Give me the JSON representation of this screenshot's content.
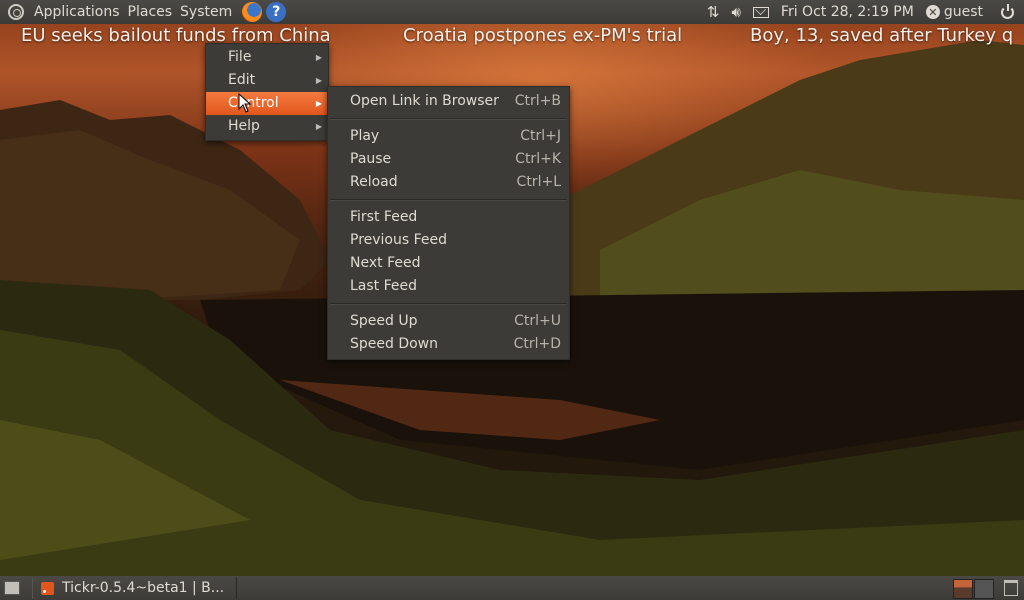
{
  "top_panel": {
    "menus": [
      "Applications",
      "Places",
      "System"
    ],
    "help_glyph": "?",
    "datetime": "Fri Oct 28,  2:19 PM",
    "user": "guest"
  },
  "ticker": {
    "headlines": [
      "EU seeks bailout funds from China",
      "Croatia postpones ex-PM's trial",
      "Boy, 13, saved after Turkey q"
    ]
  },
  "main_menu": {
    "items": [
      {
        "label": "File"
      },
      {
        "label": "Edit"
      },
      {
        "label": "Control"
      },
      {
        "label": "Help"
      }
    ]
  },
  "control_submenu": {
    "groups": [
      [
        {
          "label": "Open Link in Browser",
          "accel": "Ctrl+B"
        }
      ],
      [
        {
          "label": "Play",
          "accel": "Ctrl+J"
        },
        {
          "label": "Pause",
          "accel": "Ctrl+K"
        },
        {
          "label": "Reload",
          "accel": "Ctrl+L"
        }
      ],
      [
        {
          "label": "First Feed",
          "accel": ""
        },
        {
          "label": "Previous Feed",
          "accel": ""
        },
        {
          "label": "Next Feed",
          "accel": ""
        },
        {
          "label": "Last Feed",
          "accel": ""
        }
      ],
      [
        {
          "label": "Speed Up",
          "accel": "Ctrl+U"
        },
        {
          "label": "Speed Down",
          "accel": "Ctrl+D"
        }
      ]
    ]
  },
  "bottom_panel": {
    "task_label": "Tickr-0.5.4~beta1 | B..."
  },
  "colors": {
    "panel": "#3c3b37",
    "menu_highlight": "#e2561d",
    "menu_text": "#dfdbd2"
  },
  "icons": [
    "ubuntu-logo-icon",
    "firefox-icon",
    "help-icon",
    "network-icon",
    "volume-icon",
    "mail-icon",
    "user-icon",
    "power-icon",
    "show-desktop-icon",
    "rss-icon",
    "trash-icon"
  ]
}
